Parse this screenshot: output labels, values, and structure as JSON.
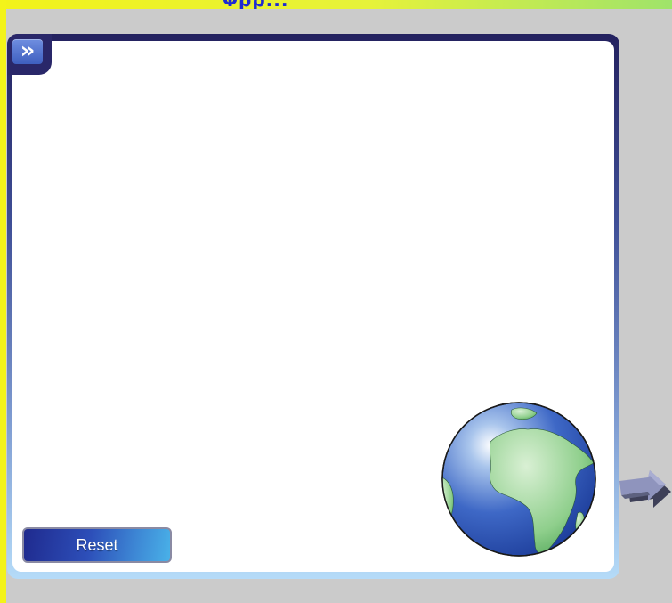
{
  "header": {
    "title": "Φρρ..."
  },
  "panel": {
    "expand_glyph": "»",
    "reset_label": "Reset"
  },
  "icons": {
    "expand": "double-chevron-right-icon",
    "globe": "earth-globe-icon",
    "next": "arrow-right-icon"
  },
  "colors": {
    "panel_top": "#23215f",
    "panel_bottom": "#b5dbf8",
    "button_accent": "#2d4fb9",
    "top_bar": "#f2f21a"
  }
}
